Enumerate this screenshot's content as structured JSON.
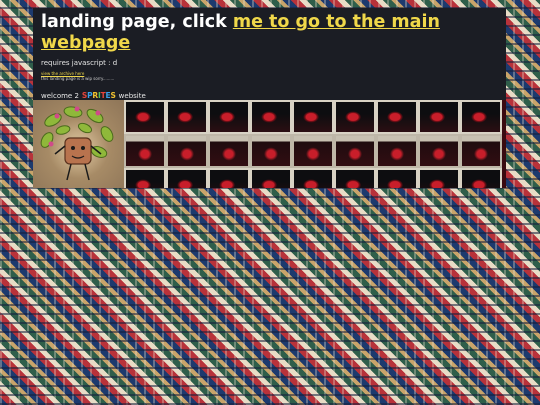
{
  "headline": {
    "lead_text": "landing page, click ",
    "link_text": "me to go to the main webpage"
  },
  "requires_text": "requires javascript : d",
  "archive_link_text": "view the archive here",
  "sorry_text": "this landing page is a wip sorry.........",
  "welcome": {
    "prefix": "welcome 2",
    "logo_text": "SPRITES",
    "suffix": "website"
  },
  "colors": {
    "panel_bg": "#1b1d24",
    "link": "#f0d84a"
  },
  "icons": {
    "plant_image": "plant-character-image",
    "tile_image": "red-object-photo-tile"
  }
}
